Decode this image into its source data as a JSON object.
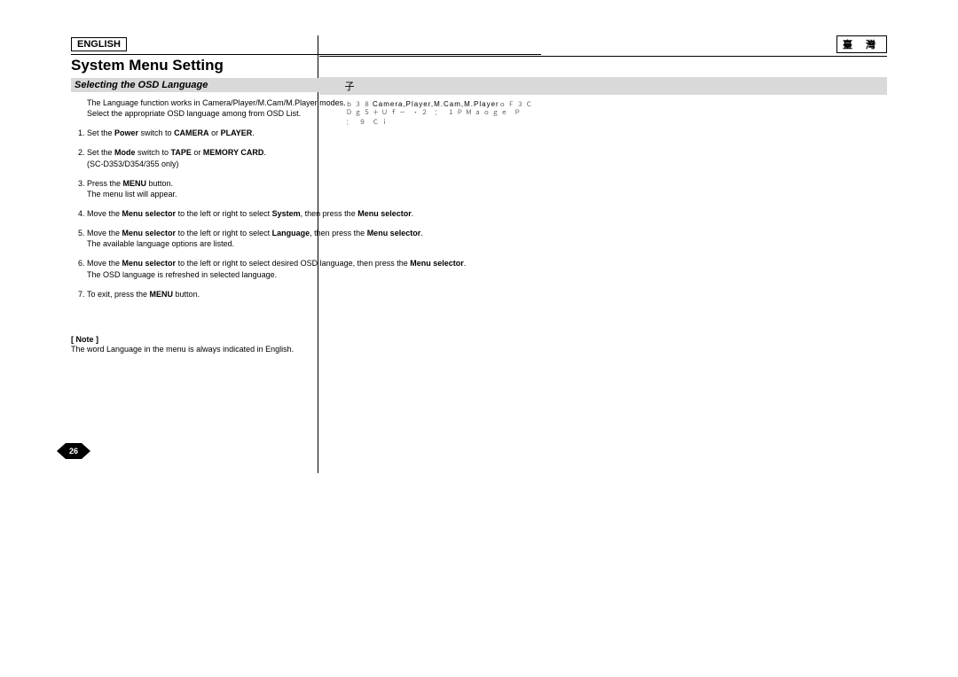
{
  "left": {
    "lang_label": "ENGLISH",
    "title": "System Menu Setting",
    "subhead": "Selecting the OSD Language",
    "intro_line1": "The Language function works in Camera/Player/M.Cam/M.Player modes.",
    "intro_line2": "Select the appropriate OSD language among from OSD List.",
    "steps": {
      "s1_a": "Set the ",
      "s1_b": "Power",
      "s1_c": " switch to ",
      "s1_d": "CAMERA",
      "s1_e": " or ",
      "s1_f": "PLAYER",
      "s1_g": ".",
      "s2_a": "Set the ",
      "s2_b": "Mode",
      "s2_c": " switch to ",
      "s2_d": "TAPE",
      "s2_e": " or ",
      "s2_f": "MEMORY CARD",
      "s2_g": ".",
      "s2_sub": "(SC-D353/D354/355 only)",
      "s3_a": "Press the ",
      "s3_b": "MENU",
      "s3_c": " button.",
      "s3_sub": "The menu list will appear.",
      "s4_a": "Move the ",
      "s4_b": "Menu selector",
      "s4_c": " to the left or right to select ",
      "s4_d": "System",
      "s4_e": ", then press the ",
      "s4_f": "Menu selector",
      "s4_g": ".",
      "s5_a": "Move the ",
      "s5_b": "Menu selector",
      "s5_c": " to the left or right to select ",
      "s5_d": "Language",
      "s5_e": ", then press the ",
      "s5_f": "Menu selector",
      "s5_g": ".",
      "s5_sub": "The available language options are listed.",
      "s6_a": "Move the ",
      "s6_b": "Menu selector",
      "s6_c": " to the left or right to select desired OSD language, then press the ",
      "s6_d": "Menu selector",
      "s6_e": ".",
      "s6_sub": "The OSD language is refreshed in selected language.",
      "s7_a": "To exit, press the ",
      "s7_b": "MENU",
      "s7_c": " button."
    },
    "note_head": "[ Note ]",
    "note_body": "The word  Language  in the menu is always indicated in English.",
    "page_number": "26"
  },
  "right": {
    "lang_label": "臺 灣",
    "subhead": "子",
    "line1_pre": "ｂ３８",
    "line1_mid": "Camera,Player,M.Cam,M.Player",
    "line1_post": "ｏＦ３Ｃ",
    "line2": "Ｄｇ５＋Ｕｆ－  ・２  ： １ＰＭａｏｇｅ     Ｐ",
    "line3": "：  ９    Ｃｉ"
  }
}
